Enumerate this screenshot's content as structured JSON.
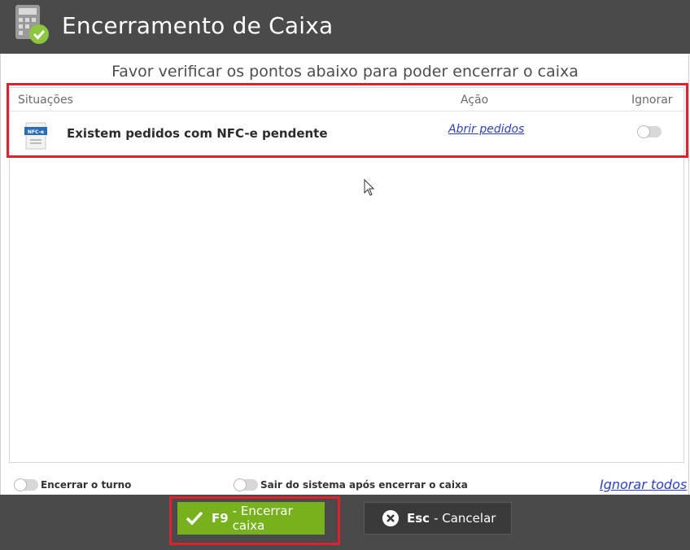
{
  "window": {
    "title": "Encerramento de Caixa",
    "icon": "calculator-check-icon"
  },
  "subtitle": "Favor verificar os pontos abaixo para poder encerrar o caixa",
  "table": {
    "columns": [
      "Situações",
      "Ação",
      "Ignorar"
    ],
    "rows": [
      {
        "icon": "nfce-document-icon",
        "icon_text": "NFC-e",
        "situation": "Existem pedidos com NFC-e pendente",
        "action": "Abrir pedidos",
        "ignore": false
      }
    ]
  },
  "options": {
    "end_shift_label": "Encerrar o turno",
    "end_shift": false,
    "exit_system_label": "Sair do sistema após encerrar o caixa",
    "exit_system": false,
    "ignore_all": "Ignorar todos"
  },
  "buttons": {
    "confirm_key": "F9",
    "confirm_label": "- Encerrar caixa",
    "cancel_key": "Esc",
    "cancel_label": "- Cancelar"
  },
  "colors": {
    "titlebar": "#4a4a4a",
    "confirm": "#77b21e",
    "highlight": "#e0202b",
    "link": "#2b3fd4"
  }
}
